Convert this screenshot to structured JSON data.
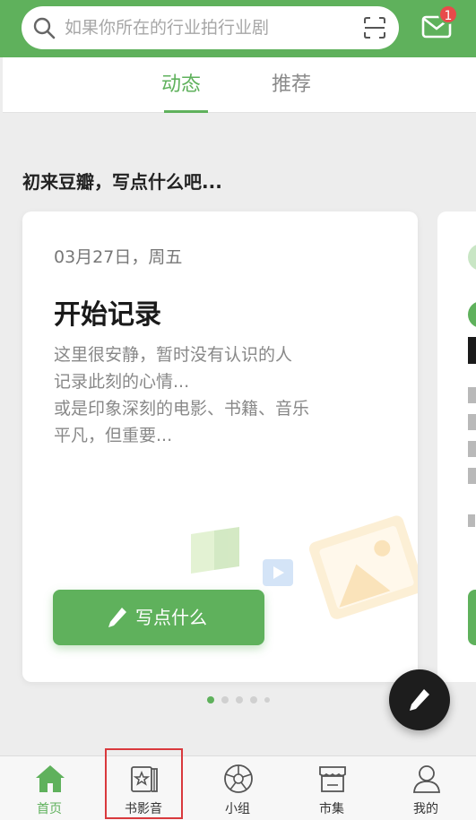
{
  "search": {
    "placeholder": "如果你所在的行业拍行业剧"
  },
  "mail": {
    "badge_count": "1"
  },
  "tabs": [
    {
      "label": "动态",
      "active": true
    },
    {
      "label": "推荐",
      "active": false
    }
  ],
  "feed": {
    "hint": "初来豆瓣，写点什么吧...",
    "card": {
      "date": "03月27日，周五",
      "title": "开始记录",
      "lines": [
        "这里很安静，暂时没有认识的人",
        "记录此刻的心情...",
        "或是印象深刻的电影、书籍、音乐",
        "平凡，但重要..."
      ],
      "button_label": "写点什么"
    },
    "pagination": {
      "total": 5,
      "current": 1
    }
  },
  "bottom_nav": [
    {
      "label": "首页",
      "icon": "home-icon",
      "active": true
    },
    {
      "label": "书影音",
      "icon": "book-movie-music-icon",
      "active": false
    },
    {
      "label": "小组",
      "icon": "group-icon",
      "active": false
    },
    {
      "label": "市集",
      "icon": "market-icon",
      "active": false
    },
    {
      "label": "我的",
      "icon": "profile-icon",
      "active": false
    }
  ],
  "colors": {
    "brand_green": "#5fb15c",
    "badge_red": "#e84a4a",
    "highlight_red": "#d9393d"
  }
}
